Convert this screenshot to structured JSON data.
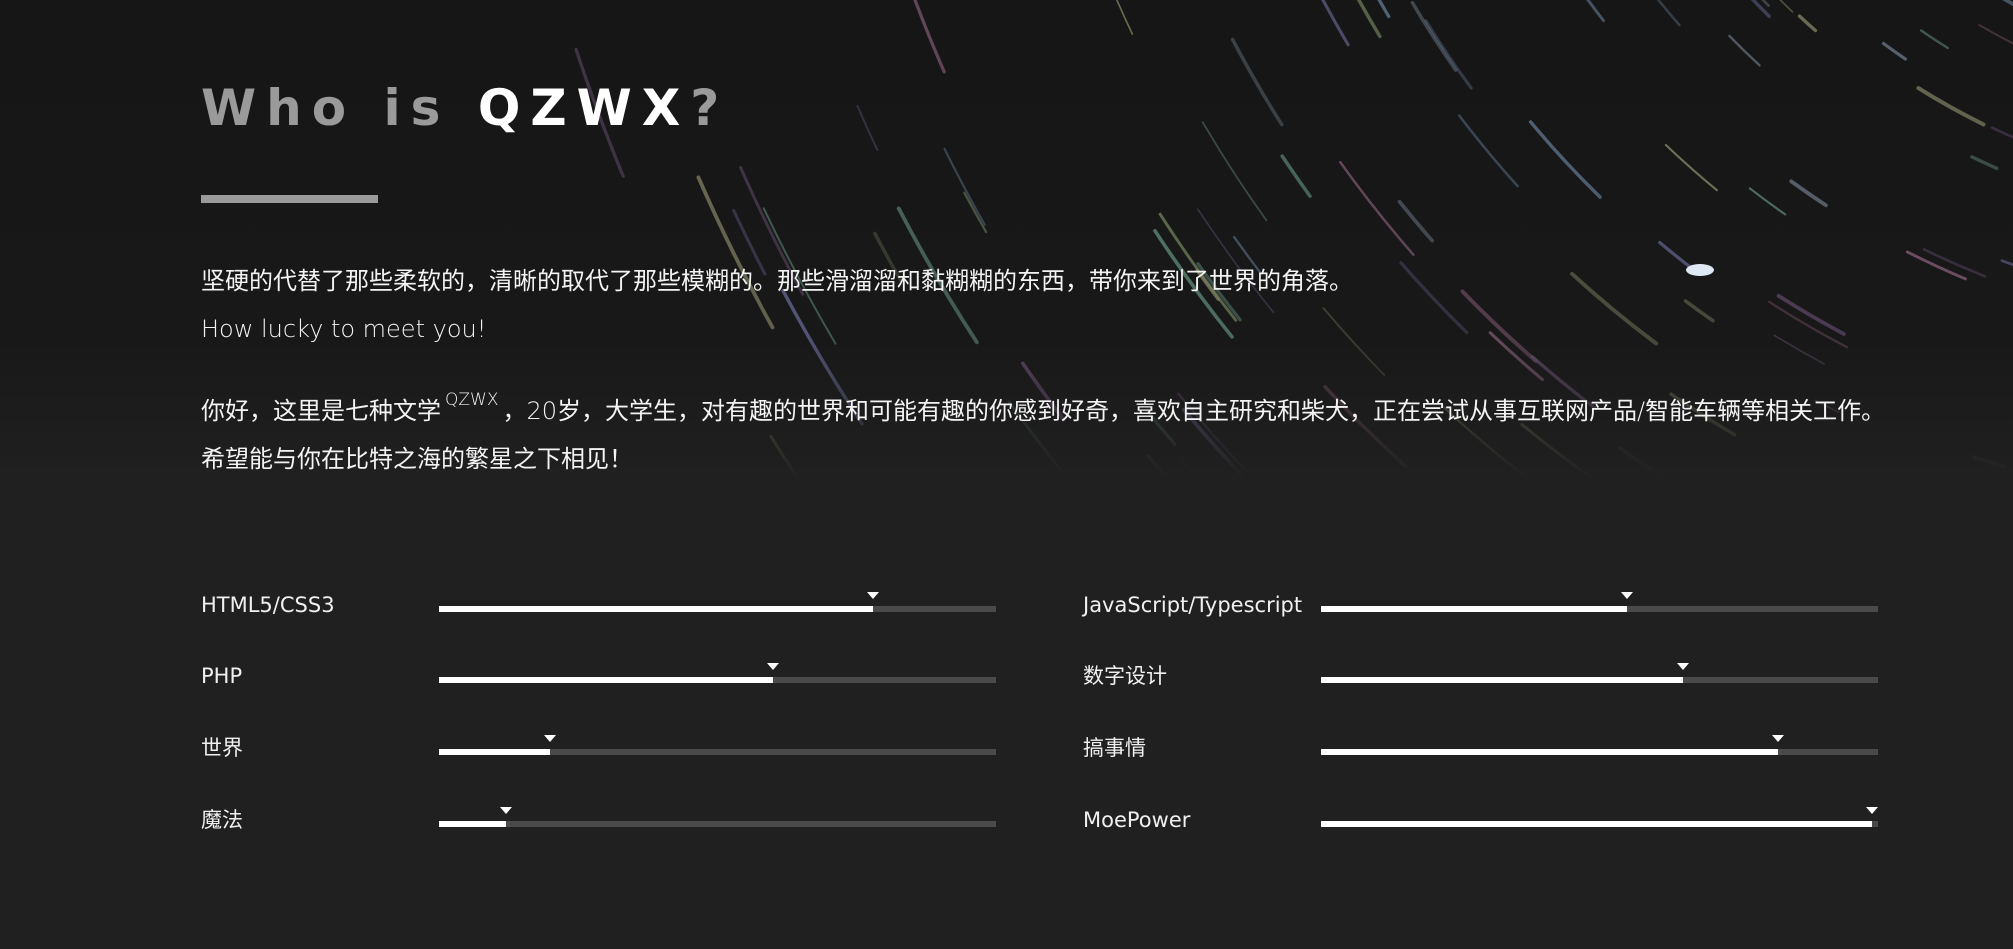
{
  "header": {
    "title_prefix": "Who is ",
    "title_name": "QZWX",
    "title_suffix": "?"
  },
  "intro": {
    "line1": "坚硬的代替了那些柔软的，清晰的取代了那些模糊的。那些滑溜溜和黏糊糊的东西，带你来到了世界的角落。",
    "line2": "How lucky to meet you!"
  },
  "about": {
    "part1": "你好，这里是七种文学",
    "sup": "QZWX",
    "part2": "，20岁，大学生，对有趣的世界和可能有趣的你感到好奇，喜欢自主研究和柴犬，正在尝试从事互联网产品/智能车辆等相关工作。",
    "line2": "希望能与你在比特之海的繁星之下相见！"
  },
  "skills": [
    {
      "label": "HTML5/CSS3",
      "level": 0.78
    },
    {
      "label": "JavaScript/Typescript",
      "level": 0.55
    },
    {
      "label": "PHP",
      "level": 0.6
    },
    {
      "label": "数字设计",
      "level": 0.65
    },
    {
      "label": "世界",
      "level": 0.2
    },
    {
      "label": "搞事情",
      "level": 0.82
    },
    {
      "label": "魔法",
      "level": 0.12
    },
    {
      "label": "MoePower",
      "level": 0.99
    }
  ],
  "colors": {
    "background": "#202020",
    "accent_bar": "#9b9b9b",
    "track": "#4a4a4a",
    "fill": "#ffffff"
  }
}
